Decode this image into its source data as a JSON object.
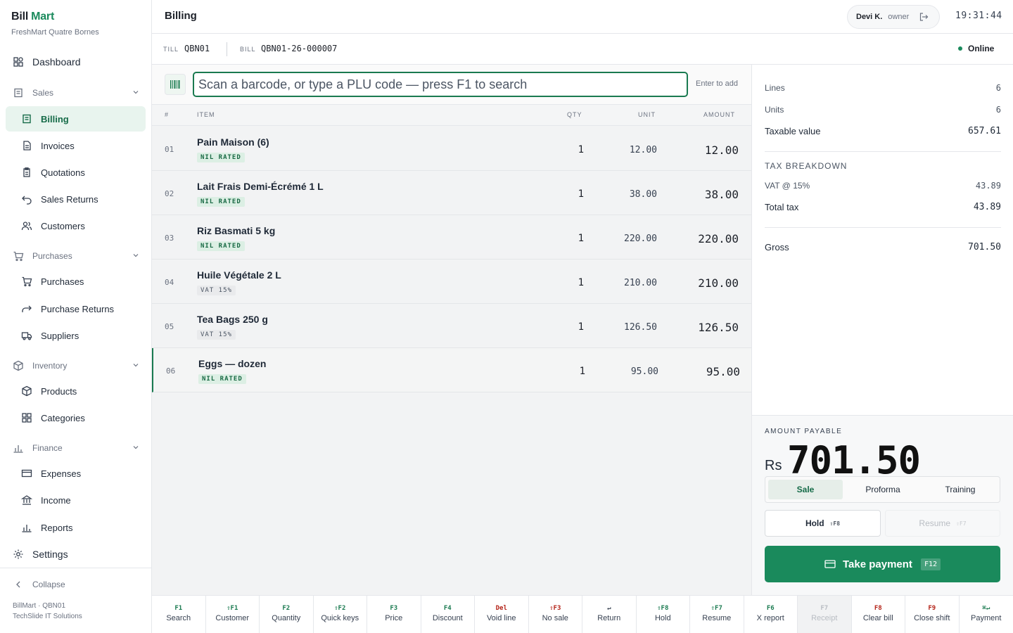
{
  "brand": {
    "name_a": "Bill",
    "name_b": "Mart",
    "store": "FreshMart Quatre Bornes"
  },
  "nav": {
    "dashboard": "Dashboard",
    "sales_group": "Sales",
    "billing": "Billing",
    "invoices": "Invoices",
    "quotations": "Quotations",
    "sales_returns": "Sales Returns",
    "customers": "Customers",
    "purchases_group": "Purchases",
    "purchases": "Purchases",
    "purchase_returns": "Purchase Returns",
    "suppliers": "Suppliers",
    "inventory_group": "Inventory",
    "products": "Products",
    "categories": "Categories",
    "finance_group": "Finance",
    "expenses": "Expenses",
    "income": "Income",
    "reports": "Reports",
    "settings": "Settings",
    "collapse": "Collapse"
  },
  "footer": {
    "line1": "BillMart · QBN01",
    "line2": "TechSlide IT Solutions"
  },
  "header": {
    "title": "Billing",
    "user_name": "Devi K.",
    "user_role": "owner",
    "clock": "19:31:44"
  },
  "session": {
    "till_label": "TILL",
    "till": "QBN01",
    "bill_label": "BILL",
    "bill": "QBN01-26-000007",
    "status": "Online"
  },
  "scan": {
    "placeholder": "Scan a barcode, or type a PLU code — press F1 to search",
    "hint": "Enter to add"
  },
  "table": {
    "headers": {
      "num": "#",
      "item": "ITEM",
      "qty": "QTY",
      "unit": "UNIT",
      "amount": "AMOUNT"
    },
    "rows": [
      {
        "num": "01",
        "name": "Pain Maison (6)",
        "tax": "NIL RATED",
        "qty": "1",
        "unit": "12.00",
        "amount": "12.00"
      },
      {
        "num": "02",
        "name": "Lait Frais Demi-Écrémé 1 L",
        "tax": "NIL RATED",
        "qty": "1",
        "unit": "38.00",
        "amount": "38.00"
      },
      {
        "num": "03",
        "name": "Riz Basmati 5 kg",
        "tax": "NIL RATED",
        "qty": "1",
        "unit": "220.00",
        "amount": "220.00"
      },
      {
        "num": "04",
        "name": "Huile Végétale 2 L",
        "tax": "VAT 15%",
        "qty": "1",
        "unit": "210.00",
        "amount": "210.00"
      },
      {
        "num": "05",
        "name": "Tea Bags 250 g",
        "tax": "VAT 15%",
        "qty": "1",
        "unit": "126.50",
        "amount": "126.50"
      },
      {
        "num": "06",
        "name": "Eggs — dozen",
        "tax": "NIL RATED",
        "qty": "1",
        "unit": "95.00",
        "amount": "95.00"
      }
    ]
  },
  "summary": {
    "lines_label": "Lines",
    "lines": "6",
    "units_label": "Units",
    "units": "6",
    "taxable_label": "Taxable value",
    "taxable": "657.61",
    "tax_breakdown_label": "TAX BREAKDOWN",
    "vat_label": "VAT @ 15%",
    "vat": "43.89",
    "total_tax_label": "Total tax",
    "total_tax": "43.89",
    "gross_label": "Gross",
    "gross": "701.50"
  },
  "payable": {
    "label": "AMOUNT PAYABLE",
    "currency": "Rs",
    "amount": "701.50",
    "modes": [
      "Sale",
      "Proforma",
      "Training"
    ],
    "hold": "Hold",
    "hold_key": "⇧F8",
    "resume": "Resume",
    "resume_key": "⇧F7",
    "pay": "Take payment",
    "pay_key": "F12"
  },
  "fkeys": [
    {
      "key": "F1",
      "label": "Search"
    },
    {
      "key": "⇧F1",
      "label": "Customer"
    },
    {
      "key": "F2",
      "label": "Quantity"
    },
    {
      "key": "⇧F2",
      "label": "Quick keys"
    },
    {
      "key": "F3",
      "label": "Price"
    },
    {
      "key": "F4",
      "label": "Discount"
    },
    {
      "key": "Del",
      "label": "Void line"
    },
    {
      "key": "⇧F3",
      "label": "No sale"
    },
    {
      "key": "↵",
      "label": "Return"
    },
    {
      "key": "⇧F8",
      "label": "Hold"
    },
    {
      "key": "⇧F7",
      "label": "Resume"
    },
    {
      "key": "F6",
      "label": "X report"
    },
    {
      "key": "F7",
      "label": "Receipt"
    },
    {
      "key": "F8",
      "label": "Clear bill"
    },
    {
      "key": "F9",
      "label": "Close shift"
    },
    {
      "key": "⌘↵",
      "label": "Payment"
    }
  ],
  "colors": {
    "accent": "#1a8a5c",
    "accent_dark": "#1a7a50",
    "danger": "#b42318"
  }
}
